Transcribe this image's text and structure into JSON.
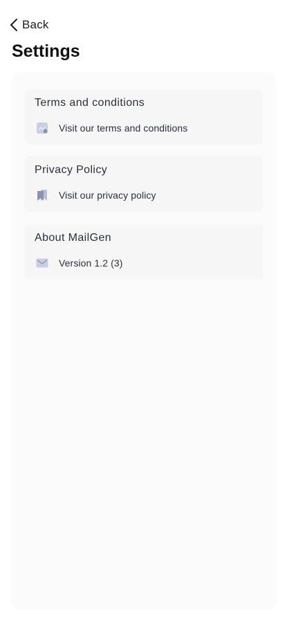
{
  "nav": {
    "back_label": "Back",
    "back_icon": "chevron-left-icon"
  },
  "page": {
    "title": "Settings"
  },
  "sections": [
    {
      "title": "Terms and conditions",
      "link_label": "Visit our terms and conditions",
      "icon": "document-icon"
    },
    {
      "title": "Privacy Policy",
      "link_label": "Visit our privacy policy",
      "icon": "bookmark-icon"
    },
    {
      "title": "About MailGen",
      "link_label": "Version 1.2 (3)",
      "icon": "mail-icon"
    }
  ],
  "colors": {
    "background": "#ffffff",
    "panel": "#fbfbfb",
    "card": "#f6f6f7",
    "icon": "#b9c0d4",
    "icon_dark": "#8a93ad",
    "text": "#2b2f3a"
  }
}
